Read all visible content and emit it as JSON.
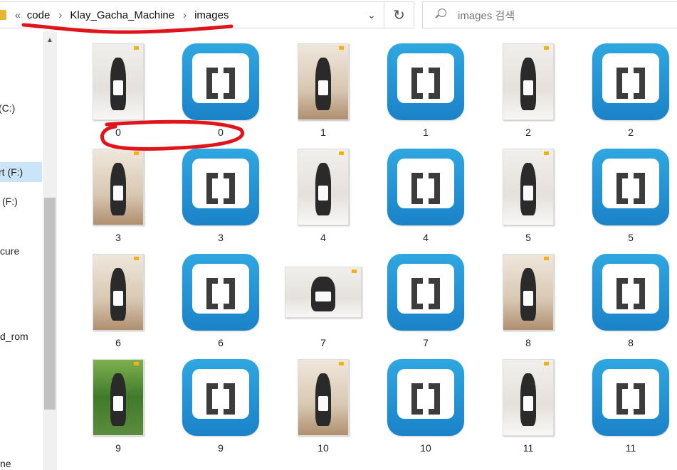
{
  "address_bar": {
    "overflow": "«",
    "breadcrumbs": [
      "code",
      "Klay_Gacha_Machine",
      "images"
    ],
    "separator": "›",
    "dropdown_icon": "chevron-down-icon",
    "refresh_icon": "refresh-icon"
  },
  "search": {
    "placeholder": "images 검색",
    "icon": "search-icon"
  },
  "nav": {
    "items": [
      {
        "label": "(C:)",
        "selected": false
      },
      {
        "label": "rt (F:)",
        "selected": true
      },
      {
        "label": "(F:)",
        "selected": false
      },
      {
        "label": "cure",
        "selected": false
      },
      {
        "label": "d_rom",
        "selected": false
      },
      {
        "label": "ne",
        "selected": false
      }
    ],
    "scroll_up_icon": "scroll-up-arrow-icon"
  },
  "files": [
    {
      "name": "0",
      "kind": "photo"
    },
    {
      "name": "0",
      "kind": "brackets"
    },
    {
      "name": "1",
      "kind": "photo"
    },
    {
      "name": "1",
      "kind": "brackets"
    },
    {
      "name": "2",
      "kind": "photo"
    },
    {
      "name": "2",
      "kind": "brackets"
    },
    {
      "name": "3",
      "kind": "photo"
    },
    {
      "name": "3",
      "kind": "brackets"
    },
    {
      "name": "4",
      "kind": "photo"
    },
    {
      "name": "4",
      "kind": "brackets"
    },
    {
      "name": "5",
      "kind": "photo"
    },
    {
      "name": "5",
      "kind": "brackets"
    },
    {
      "name": "6",
      "kind": "photo"
    },
    {
      "name": "6",
      "kind": "brackets"
    },
    {
      "name": "7",
      "kind": "photo"
    },
    {
      "name": "7",
      "kind": "brackets"
    },
    {
      "name": "8",
      "kind": "photo"
    },
    {
      "name": "8",
      "kind": "brackets"
    },
    {
      "name": "9",
      "kind": "photo"
    },
    {
      "name": "9",
      "kind": "brackets"
    },
    {
      "name": "10",
      "kind": "photo"
    },
    {
      "name": "10",
      "kind": "brackets"
    },
    {
      "name": "11",
      "kind": "photo"
    },
    {
      "name": "11",
      "kind": "brackets"
    }
  ],
  "colors": {
    "brackets_blue": "#1b82c8",
    "selection": "#cce4f7",
    "annotation_red": "#e0141b"
  }
}
